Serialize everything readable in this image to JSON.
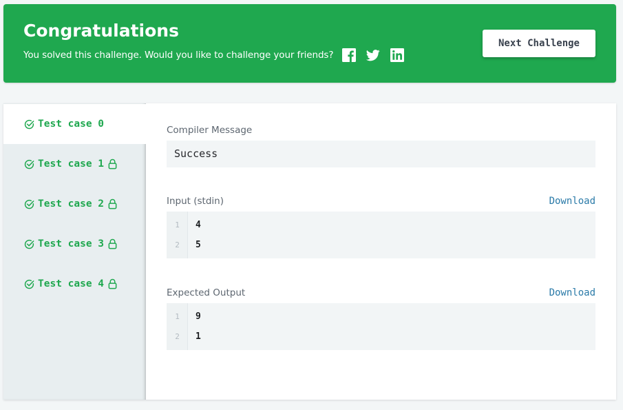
{
  "banner": {
    "title": "Congratulations",
    "subtitle": "You solved this challenge. Would you like to challenge your friends?",
    "social_icons": [
      "facebook-icon",
      "twitter-icon",
      "linkedin-icon"
    ],
    "next_button_label": "Next Challenge",
    "color": "#1fa84f"
  },
  "test_cases": [
    {
      "label": "Test case 0",
      "passed": true,
      "locked": false,
      "active": true
    },
    {
      "label": "Test case 1",
      "passed": true,
      "locked": true,
      "active": false
    },
    {
      "label": "Test case 2",
      "passed": true,
      "locked": true,
      "active": false
    },
    {
      "label": "Test case 3",
      "passed": true,
      "locked": true,
      "active": false
    },
    {
      "label": "Test case 4",
      "passed": true,
      "locked": true,
      "active": false
    }
  ],
  "compiler": {
    "label": "Compiler Message",
    "message": "Success"
  },
  "input": {
    "label": "Input (stdin)",
    "download_label": "Download",
    "lines": [
      {
        "num": "1",
        "text": "4"
      },
      {
        "num": "2",
        "text": "5"
      }
    ]
  },
  "expected": {
    "label": "Expected Output",
    "download_label": "Download",
    "lines": [
      {
        "num": "1",
        "text": "9"
      },
      {
        "num": "2",
        "text": "1"
      }
    ]
  },
  "colors": {
    "accent": "#1fa84f",
    "link": "#2a7aa8",
    "sidebar_bg": "#e8eef0",
    "code_bg": "#f2f5f6"
  }
}
